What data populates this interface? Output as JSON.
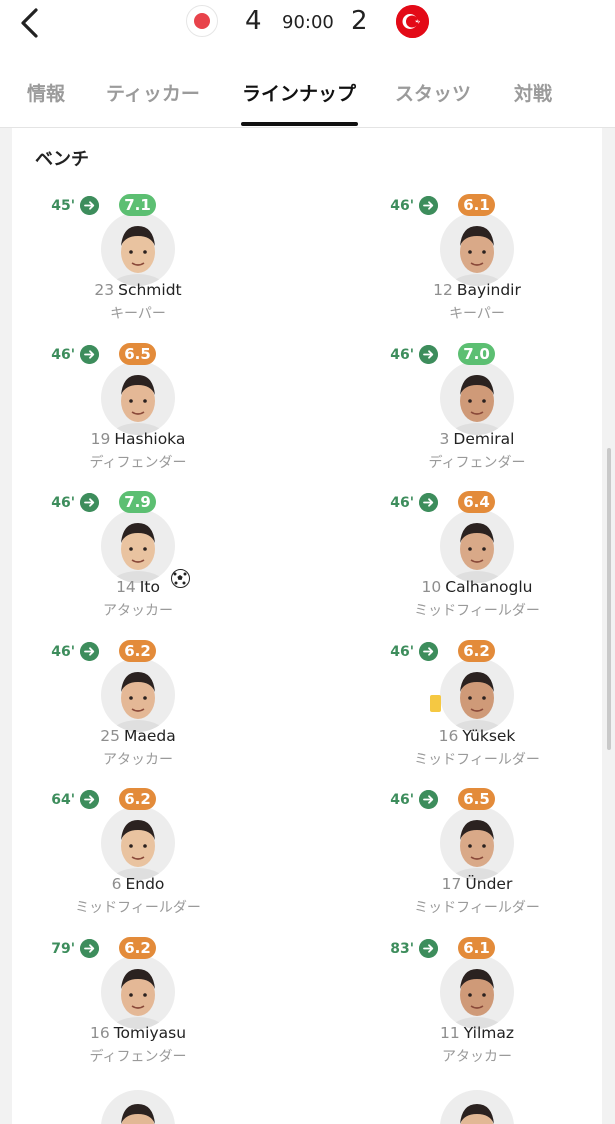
{
  "match": {
    "home_score": "4",
    "away_score": "2",
    "clock": "90:00",
    "home_flag": "japan-flag-icon",
    "away_flag": "turkey-flag-icon"
  },
  "tabs": [
    "情報",
    "ティッカー",
    "ラインナップ",
    "スタッツ",
    "対戦"
  ],
  "active_tab": "ラインナップ",
  "section_title": "ベンチ",
  "colors": {
    "rating_high": "#5cbf72",
    "rating_mid": "#e38b3a",
    "sub_green": "#3d8d5c",
    "tab_active": "#111111",
    "tab_inactive": "#9b9b9b"
  },
  "players": [
    {
      "minute": "45'",
      "rating": "7.1",
      "rating_color": "#5cbf72",
      "number": "23",
      "name": "Schmidt",
      "position": "キーパー",
      "team": "home",
      "event": ""
    },
    {
      "minute": "46'",
      "rating": "6.1",
      "rating_color": "#e38b3a",
      "number": "12",
      "name": "Bayindir",
      "position": "キーパー",
      "team": "away",
      "event": ""
    },
    {
      "minute": "46'",
      "rating": "6.5",
      "rating_color": "#e38b3a",
      "number": "19",
      "name": "Hashioka",
      "position": "ディフェンダー",
      "team": "home",
      "event": ""
    },
    {
      "minute": "46'",
      "rating": "7.0",
      "rating_color": "#5cbf72",
      "number": "3",
      "name": "Demiral",
      "position": "ディフェンダー",
      "team": "away",
      "event": ""
    },
    {
      "minute": "46'",
      "rating": "7.9",
      "rating_color": "#5cbf72",
      "number": "14",
      "name": "Ito",
      "position": "アタッカー",
      "team": "home",
      "event": "goal"
    },
    {
      "minute": "46'",
      "rating": "6.4",
      "rating_color": "#e38b3a",
      "number": "10",
      "name": "Calhanoglu",
      "position": "ミッドフィールダー",
      "team": "away",
      "event": ""
    },
    {
      "minute": "46'",
      "rating": "6.2",
      "rating_color": "#e38b3a",
      "number": "25",
      "name": "Maeda",
      "position": "アタッカー",
      "team": "home",
      "event": ""
    },
    {
      "minute": "46'",
      "rating": "6.2",
      "rating_color": "#e38b3a",
      "number": "16",
      "name": "Yüksek",
      "position": "ミッドフィールダー",
      "team": "away",
      "event": "yellow-card"
    },
    {
      "minute": "64'",
      "rating": "6.2",
      "rating_color": "#e38b3a",
      "number": "6",
      "name": "Endo",
      "position": "ミッドフィールダー",
      "team": "home",
      "event": ""
    },
    {
      "minute": "46'",
      "rating": "6.5",
      "rating_color": "#e38b3a",
      "number": "17",
      "name": "Ünder",
      "position": "ミッドフィールダー",
      "team": "away",
      "event": ""
    },
    {
      "minute": "79'",
      "rating": "6.2",
      "rating_color": "#e38b3a",
      "number": "16",
      "name": "Tomiyasu",
      "position": "ディフェンダー",
      "team": "home",
      "event": ""
    },
    {
      "minute": "83'",
      "rating": "6.1",
      "rating_color": "#e38b3a",
      "number": "11",
      "name": "Yilmaz",
      "position": "アタッカー",
      "team": "away",
      "event": ""
    }
  ]
}
